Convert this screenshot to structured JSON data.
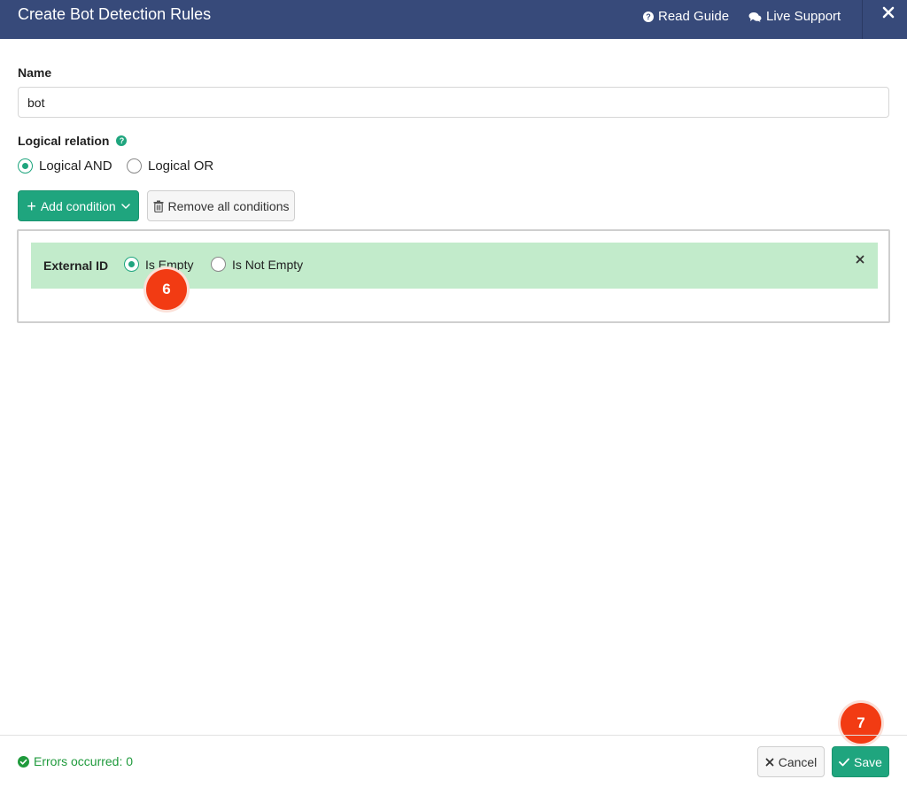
{
  "header": {
    "title": "Create Bot Detection Rules",
    "read_guide": "Read Guide",
    "live_support": "Live Support",
    "background_color": "#374a7a"
  },
  "form": {
    "name_label": "Name",
    "name_value": "bot",
    "logical_relation_label": "Logical relation",
    "logical_options": [
      {
        "label": "Logical AND",
        "selected": true
      },
      {
        "label": "Logical OR",
        "selected": false
      }
    ],
    "add_condition_label": "Add condition",
    "remove_all_label": "Remove all conditions"
  },
  "conditions": [
    {
      "field": "External ID",
      "options": [
        {
          "label": "Is Empty",
          "selected": true
        },
        {
          "label": "Is Not Empty",
          "selected": false
        }
      ]
    }
  ],
  "annotations": {
    "step_6": "6",
    "step_7": "7"
  },
  "footer": {
    "errors_text": "Errors occurred: 0",
    "cancel_label": "Cancel",
    "save_label": "Save"
  },
  "colors": {
    "accent": "#1fa57e",
    "condition_row": "#c2ebcb",
    "badge": "#f23b13",
    "success_text": "#1f9a3c"
  },
  "icons": {
    "read_guide": "question-circle-icon",
    "live_support": "chat-bubbles-icon",
    "close": "close-icon",
    "help": "help-icon",
    "add": "plus-icon",
    "dropdown": "chevron-down-icon",
    "trash": "trash-icon",
    "condition_close": "close-icon",
    "errors": "check-circle-icon",
    "cancel": "x-icon",
    "save": "check-icon"
  }
}
